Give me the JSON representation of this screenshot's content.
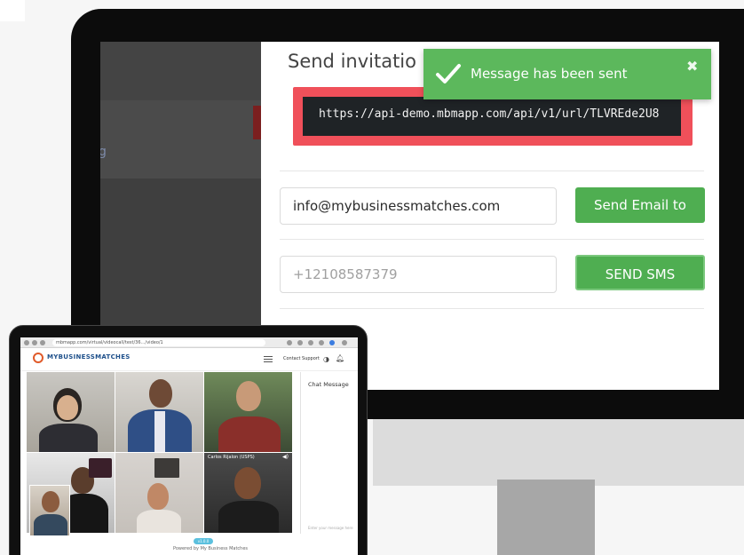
{
  "modal": {
    "title": "Send invitatio",
    "url": "https://api-demo.mbmapp.com/api/v1/url/TLVREde2U8",
    "email_value": "info@mybusinessmatches.com",
    "send_email_label": "Send Email to",
    "phone_placeholder": "+12108587379",
    "send_sms_label": "SEND SMS",
    "dimmed_glyph": "g"
  },
  "toast": {
    "message": "Message has been sent",
    "close_glyph": "✖"
  },
  "laptop": {
    "browser_url": "mbmapp.com/virtual/videocall/test/36…/video/1",
    "logo": "MYBUSINESSMATCHES",
    "contact_support": "Contact Support",
    "chat_title": "Chat Message",
    "chat_placeholder": "Enter your message here",
    "tile_label": "Carlos Rijalon (USPS)",
    "footer_badge": "v1.0.0",
    "footer_text": "Powered by My Business Matches"
  },
  "colors": {
    "accent_green": "#4fae51",
    "toast_green": "#5cb85c",
    "highlight_red": "#f0505a",
    "url_bg": "#1f2326"
  }
}
